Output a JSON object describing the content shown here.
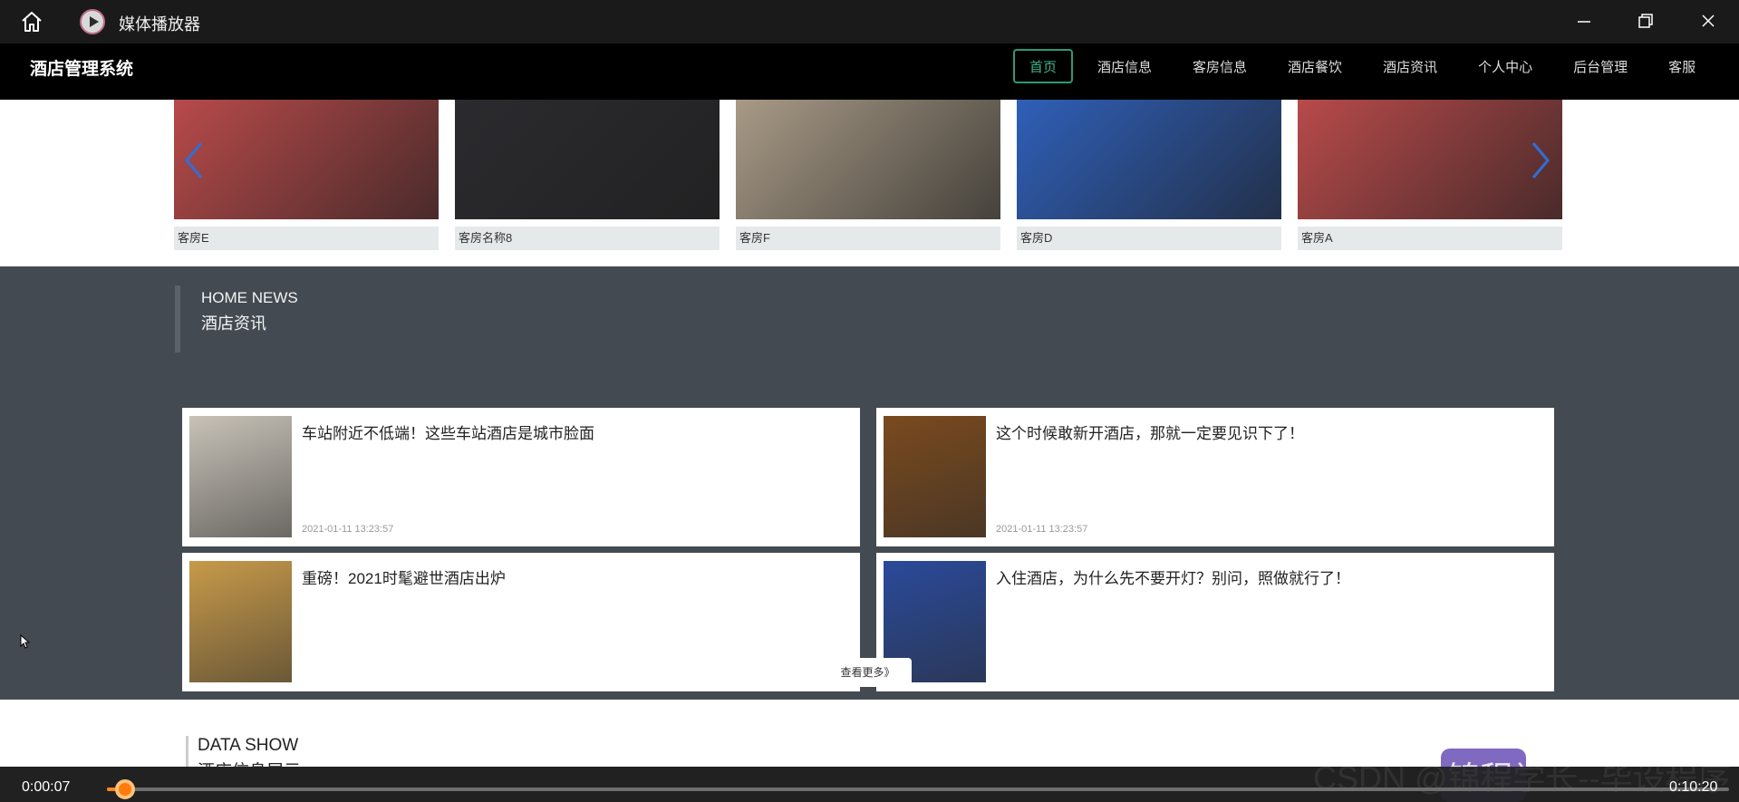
{
  "player": {
    "title": "媒体播放器",
    "current_time": "0:00:07",
    "duration": "0:10:20",
    "progress_fraction": 0.011
  },
  "site": {
    "brand": "酒店管理系统",
    "nav": [
      {
        "label": "首页",
        "active": true
      },
      {
        "label": "酒店信息"
      },
      {
        "label": "客房信息"
      },
      {
        "label": "酒店餐饮"
      },
      {
        "label": "酒店资讯"
      },
      {
        "label": "个人中心"
      },
      {
        "label": "后台管理"
      },
      {
        "label": "客服"
      }
    ],
    "rooms": [
      {
        "caption": "客房E",
        "tone": "#b84a4a"
      },
      {
        "caption": "客房名称8",
        "tone": "#2b2a2e"
      },
      {
        "caption": "客房F",
        "tone": "#a89a86"
      },
      {
        "caption": "客房D",
        "tone": "#2f5fb8"
      },
      {
        "caption": "客房A",
        "tone": "#b84a4a"
      }
    ],
    "news": {
      "en": "HOME NEWS",
      "cn": "酒店资讯",
      "items": [
        {
          "title": "车站附近不低端！这些车站酒店是城市脸面",
          "date": "2021-01-11 13:23:57",
          "thumb": "#c8c2b8"
        },
        {
          "title": "这个时候敢新开酒店，那就一定要见识下了！",
          "date": "2021-01-11 13:23:57",
          "thumb": "#7a4a1e"
        },
        {
          "title": "重磅！2021时髦避世酒店出炉",
          "date": "",
          "thumb": "#c79a4a"
        },
        {
          "title": "入住酒店，为什么先不要开灯？别问，照做就行了！",
          "date": "",
          "thumb": "#2a4a9a"
        }
      ],
      "more_label": "查看更多》"
    },
    "datashow": {
      "en": "DATA SHOW",
      "cn": "酒店信息展示"
    }
  },
  "watermark": "CSDN @锦程学长--毕设程序",
  "colors": {
    "accent": "#ff8a1e",
    "nav_active": "#3cb68c",
    "news_bg": "#434a52"
  }
}
